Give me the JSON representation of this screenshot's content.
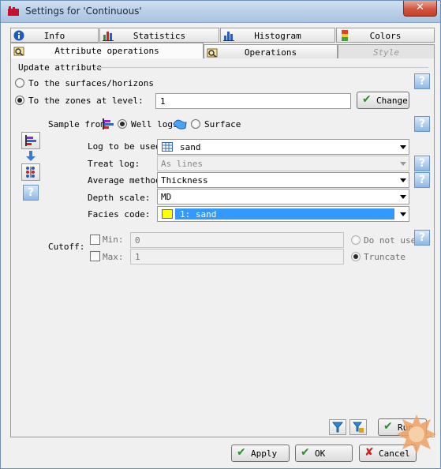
{
  "window": {
    "title": "Settings for 'Continuous'",
    "close_glyph": "✕"
  },
  "tabs_top": [
    {
      "label": "Info",
      "icon": "info-icon"
    },
    {
      "label": "Statistics",
      "icon": "statistics-icon"
    },
    {
      "label": "Histogram",
      "icon": "histogram-icon"
    },
    {
      "label": "Colors",
      "icon": "colors-icon"
    }
  ],
  "tabs_bottom": [
    {
      "label": "Attribute operations",
      "icon": "attribute-operations-icon",
      "active": true
    },
    {
      "label": "Operations",
      "icon": "operations-icon"
    },
    {
      "label": "Style",
      "disabled": true
    }
  ],
  "update": {
    "section_label": "Update attribute",
    "option_surfaces": "To the surfaces/horizons",
    "option_zones": "To the zones at level:",
    "zones_level_value": "1",
    "change_button": "Change"
  },
  "sample": {
    "label": "Sample from",
    "well_logs": "Well logs",
    "surface": "Surface"
  },
  "rows": {
    "log_to_use": {
      "label": "Log to be used",
      "value": "sand"
    },
    "treat_log": {
      "label": "Treat log:",
      "value": "As lines"
    },
    "average_method": {
      "label": "Average method",
      "value": "Thickness"
    },
    "depth_scale": {
      "label": "Depth scale:",
      "value": "MD"
    },
    "facies_code": {
      "label": "Facies code:",
      "value": "1: sand",
      "swatch_color": "#ffff00"
    }
  },
  "cutoff": {
    "label": "Cutoff:",
    "min_label": "Min:",
    "min_value": "0",
    "max_label": "Max:",
    "max_value": "1",
    "do_not_use": "Do not use",
    "truncate": "Truncate"
  },
  "help_glyph": "?",
  "run_button": "Run",
  "footer": {
    "apply": "Apply",
    "ok": "OK",
    "cancel": "Cancel"
  },
  "colors": {
    "accent_blue": "#3366cc",
    "help_blue": "#8fb8e6",
    "check_green": "#2e8b2e",
    "cancel_red": "#cc2222",
    "selection_blue": "#3399ff"
  }
}
